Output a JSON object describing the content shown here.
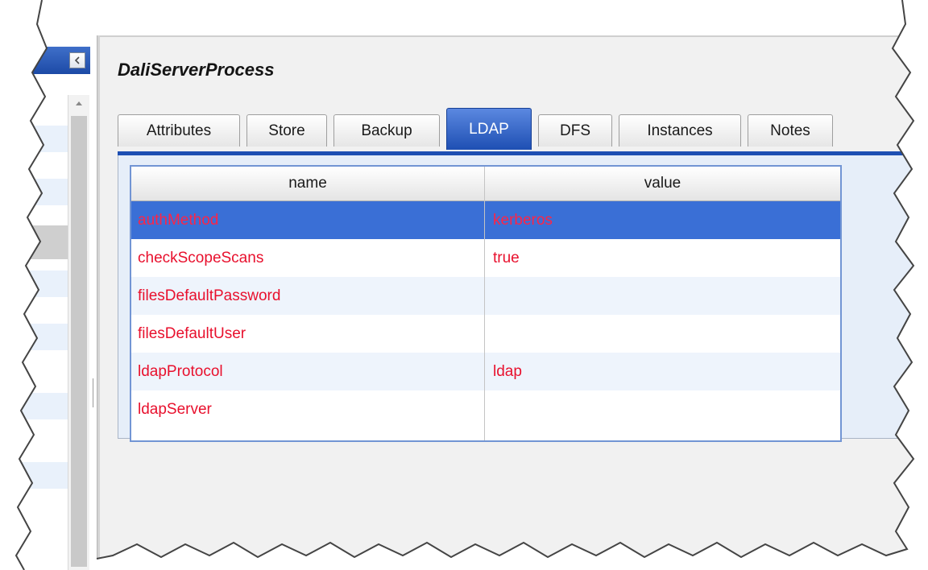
{
  "sidebar": {
    "collapse_icon": "chevron-left-icon",
    "scroll_icon": "caret-up-icon"
  },
  "page": {
    "title": "DaliServerProcess"
  },
  "tabs": [
    {
      "label": "Attributes",
      "active": false
    },
    {
      "label": "Store",
      "active": false
    },
    {
      "label": "Backup",
      "active": false
    },
    {
      "label": "LDAP",
      "active": true
    },
    {
      "label": "DFS",
      "active": false
    },
    {
      "label": "Instances",
      "active": false
    },
    {
      "label": "Notes",
      "active": false
    }
  ],
  "grid": {
    "columns": [
      "name",
      "value"
    ],
    "rows": [
      {
        "name": "authMethod",
        "value": "kerberos",
        "selected": true
      },
      {
        "name": "checkScopeScans",
        "value": "true",
        "selected": false
      },
      {
        "name": "filesDefaultPassword",
        "value": "",
        "selected": false
      },
      {
        "name": "filesDefaultUser",
        "value": "",
        "selected": false
      },
      {
        "name": "ldapProtocol",
        "value": "ldap",
        "selected": false
      },
      {
        "name": "ldapServer",
        "value": "",
        "selected": false
      }
    ]
  },
  "colors": {
    "accent": "#1e4fb3",
    "selected_row": "#3a6fd6",
    "text_red": "#e8102d"
  }
}
